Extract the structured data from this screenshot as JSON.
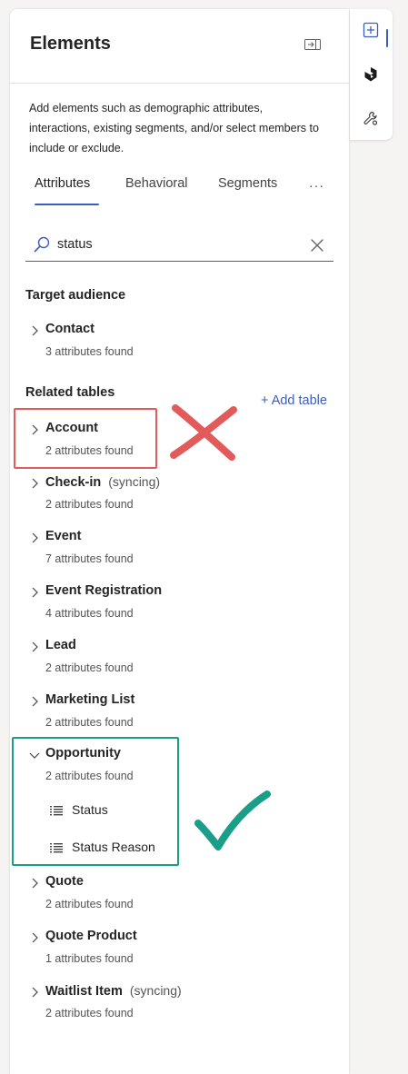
{
  "panel": {
    "title": "Elements",
    "description": "Add elements such as demographic attributes, interactions, existing segments, and/or select members to include or exclude.",
    "collapse_icon": "panel-collapse-icon"
  },
  "tabs": [
    {
      "label": "Attributes",
      "active": true
    },
    {
      "label": "Behavioral",
      "active": false
    },
    {
      "label": "Segments",
      "active": false
    }
  ],
  "more_label": "···",
  "search": {
    "value": "status",
    "placeholder": "Search"
  },
  "target_audience": {
    "heading": "Target audience",
    "items": [
      {
        "name": "Contact",
        "count": "3 attributes found"
      }
    ]
  },
  "related_tables": {
    "heading": "Related tables",
    "add_label": "+ Add table",
    "items": [
      {
        "name": "Account",
        "sync": "",
        "count": "2 attributes found"
      },
      {
        "name": "Check-in",
        "sync": "(syncing)",
        "count": "2 attributes found"
      },
      {
        "name": "Event",
        "sync": "",
        "count": "7 attributes found"
      },
      {
        "name": "Event Registration",
        "sync": "",
        "count": "4 attributes found"
      },
      {
        "name": "Lead",
        "sync": "",
        "count": "2 attributes found"
      },
      {
        "name": "Marketing List",
        "sync": "",
        "count": "2 attributes found"
      },
      {
        "name": "Opportunity",
        "sync": "",
        "count": "2 attributes found",
        "expanded": true,
        "attributes": [
          "Status",
          "Status Reason"
        ]
      },
      {
        "name": "Quote",
        "sync": "",
        "count": "2 attributes found"
      },
      {
        "name": "Quote Product",
        "sync": "",
        "count": "1 attributes found"
      },
      {
        "name": "Waitlist Item",
        "sync": "(syncing)",
        "count": "2 attributes found"
      }
    ]
  },
  "rail": {
    "icons": [
      "add-element-icon",
      "copilot-icon",
      "tools-icon"
    ]
  },
  "colors": {
    "accent": "#3b5fc0",
    "annotation_wrong": "#e35a5a",
    "annotation_right": "#1b9e87"
  }
}
